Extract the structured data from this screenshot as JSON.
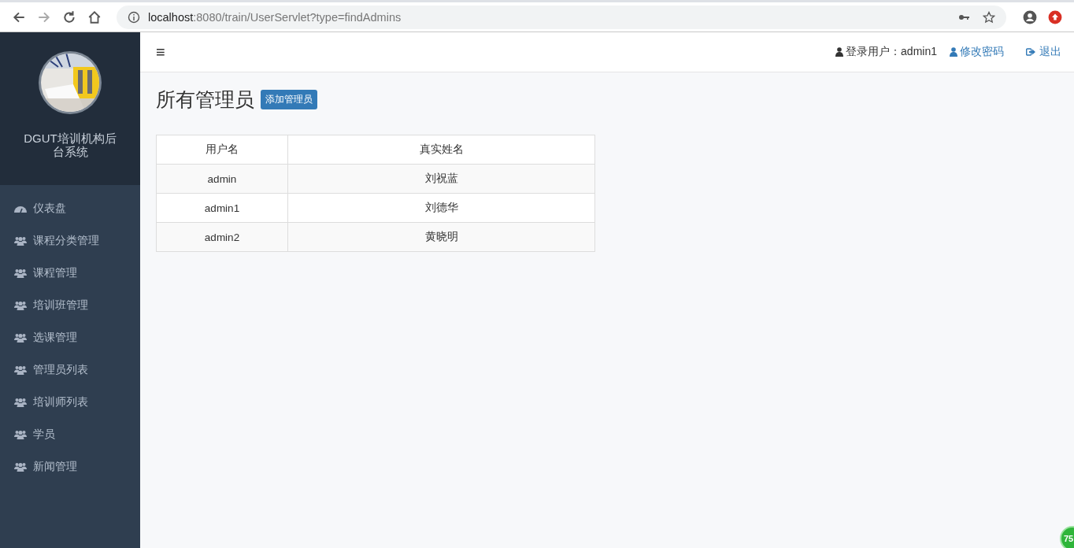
{
  "browser": {
    "url_host": "localhost",
    "url_rest": ":8080/train/UserServlet?type=findAdmins"
  },
  "sidebar": {
    "title": "DGUT培训机构后台系统",
    "items": [
      {
        "label": "仪表盘",
        "kind": "dashboard"
      },
      {
        "label": "课程分类管理",
        "kind": "users"
      },
      {
        "label": "课程管理",
        "kind": "users"
      },
      {
        "label": "培训班管理",
        "kind": "users"
      },
      {
        "label": "选课管理",
        "kind": "users"
      },
      {
        "label": "管理员列表",
        "kind": "users"
      },
      {
        "label": "培训师列表",
        "kind": "users"
      },
      {
        "label": "学员",
        "kind": "users"
      },
      {
        "label": "新闻管理",
        "kind": "users"
      }
    ]
  },
  "header": {
    "menu_icon": "≡",
    "login_user": "登录用户：admin1",
    "change_password": "修改密码",
    "logout": "退出"
  },
  "page": {
    "title": "所有管理员",
    "add_button": "添加管理员"
  },
  "table": {
    "columns": [
      "用户名",
      "真实姓名"
    ],
    "rows": [
      [
        "admin",
        "刘祝蓝"
      ],
      [
        "admin1",
        "刘德华"
      ],
      [
        "admin2",
        "黄晓明"
      ]
    ]
  },
  "badge": "75"
}
